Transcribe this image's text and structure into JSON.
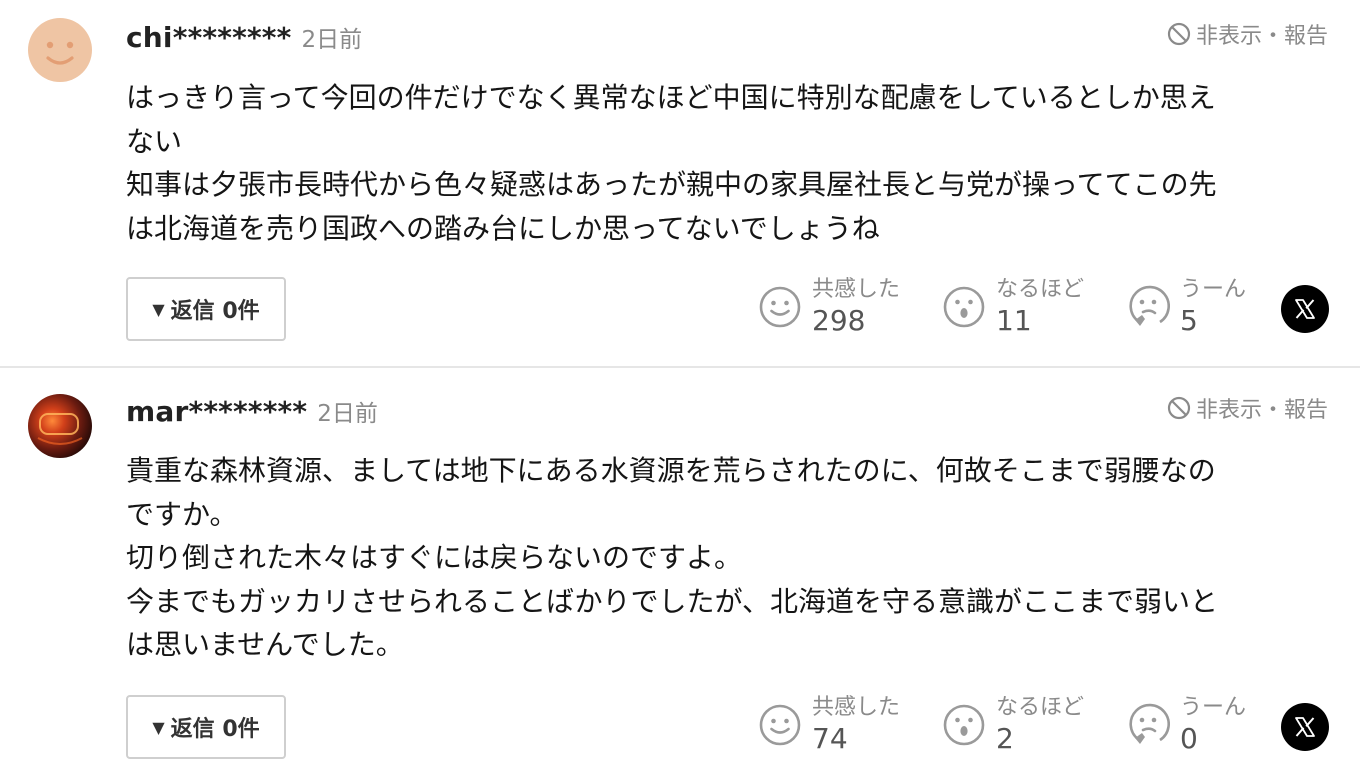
{
  "comments": [
    {
      "username": "chi********",
      "timestamp": "2日前",
      "hide_report": "非表示・報告",
      "body": [
        "はっきり言って今回の件だけでなく異常なほど中国に特別な配慮をしているとしか思え",
        "ない",
        "知事は夕張市長時代から色々疑惑はあったが親中の家具屋社長と与党が操っててこの先",
        "は北海道を売り国政への踏み台にしか思ってないでしょうね"
      ],
      "reply_label": "返信 0件",
      "reactions": [
        {
          "label": "共感した",
          "count": "298",
          "icon": "smile-face-icon"
        },
        {
          "label": "なるほど",
          "count": "11",
          "icon": "surprised-face-icon"
        },
        {
          "label": "うーん",
          "count": "5",
          "icon": "thinking-face-icon"
        }
      ],
      "share_icon": "x-logo-icon"
    },
    {
      "username": "mar********",
      "timestamp": "2日前",
      "hide_report": "非表示・報告",
      "body": [
        "貴重な森林資源、ましては地下にある水資源を荒らされたのに、何故そこまで弱腰なの",
        "ですか。",
        "切り倒された木々はすぐには戻らないのですよ。",
        "今までもガッカリさせられることばかりでしたが、北海道を守る意識がここまで弱いと",
        "は思いませんでした。"
      ],
      "reply_label": "返信 0件",
      "reactions": [
        {
          "label": "共感した",
          "count": "74",
          "icon": "smile-face-icon"
        },
        {
          "label": "なるほど",
          "count": "2",
          "icon": "surprised-face-icon"
        },
        {
          "label": "うーん",
          "count": "0",
          "icon": "thinking-face-icon"
        }
      ],
      "share_icon": "x-logo-icon"
    }
  ],
  "colors": {
    "muted_text": "#8a8a8a",
    "icon_gray": "#9a9a9a",
    "avatar1_bg": "#efc5a4"
  }
}
